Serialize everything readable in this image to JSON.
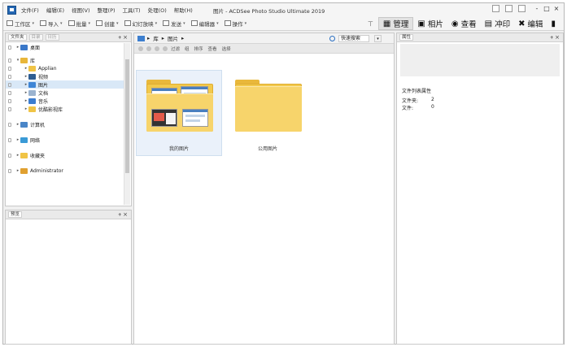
{
  "window": {
    "title": "图片 - ACDSee Photo Studio Ultimate 2019",
    "menu": [
      "文件(F)",
      "编辑(E)",
      "视图(V)",
      "整理(P)",
      "工具(T)",
      "处理(O)",
      "帮助(H)"
    ],
    "controls": {
      "minimize": "-",
      "maximize": "□",
      "close": "×"
    }
  },
  "toolbar": {
    "tools": [
      "工作区",
      "导入",
      "批量",
      "创建",
      "幻灯放映",
      "发送",
      "编辑器",
      "操作"
    ],
    "modes": [
      {
        "label": "管理",
        "icon": "grid-icon",
        "active": true
      },
      {
        "label": "相片",
        "icon": "photo-icon",
        "active": false
      },
      {
        "label": "查看",
        "icon": "eye-icon",
        "active": false
      },
      {
        "label": "冲印",
        "icon": "print-icon",
        "active": false
      },
      {
        "label": "编辑",
        "icon": "tools-icon",
        "active": false
      },
      {
        "label": "",
        "icon": "chart-icon",
        "active": false
      }
    ]
  },
  "left_pane": {
    "tabs": [
      "文件夹",
      "目录",
      "日历"
    ],
    "tree": [
      {
        "label": "桌面",
        "icon": "desktop-icon",
        "color": "#3a78c9",
        "indent": 0,
        "arrow": "▸"
      },
      {
        "label": "库",
        "icon": "library-icon",
        "color": "#e8b63a",
        "indent": 0,
        "arrow": "▾"
      },
      {
        "label": "Applian",
        "icon": "folder-icon",
        "color": "#f0c446",
        "indent": 1,
        "arrow": "▸"
      },
      {
        "label": "视频",
        "icon": "video-icon",
        "color": "#2e5d92",
        "indent": 1,
        "arrow": "▸"
      },
      {
        "label": "图片",
        "icon": "picture-icon",
        "color": "#3f86d6",
        "indent": 1,
        "arrow": "▸",
        "selected": true
      },
      {
        "label": "文档",
        "icon": "document-icon",
        "color": "#9bb3cf",
        "indent": 1,
        "arrow": "▸"
      },
      {
        "label": "音乐",
        "icon": "music-icon",
        "color": "#3b7dd0",
        "indent": 1,
        "arrow": "▸"
      },
      {
        "label": "优酷影视库",
        "icon": "folder-icon",
        "color": "#f0c446",
        "indent": 1,
        "arrow": "▸"
      },
      {
        "label": "计算机",
        "icon": "computer-icon",
        "color": "#4a86c8",
        "indent": 0,
        "arrow": "▸"
      },
      {
        "label": "网络",
        "icon": "network-icon",
        "color": "#3a9ad6",
        "indent": 0,
        "arrow": "▸"
      },
      {
        "label": "收藏夹",
        "icon": "favorites-icon",
        "color": "#f0c446",
        "indent": 0,
        "arrow": "▸"
      },
      {
        "label": "Administrator",
        "icon": "user-icon",
        "color": "#e0a030",
        "indent": 0,
        "arrow": "▸"
      }
    ]
  },
  "preview_pane": {
    "title": "预览"
  },
  "browser": {
    "breadcrumb": [
      "库",
      "图片"
    ],
    "search_label": "快速搜索",
    "filters": [
      "过滤",
      "组",
      "排序",
      "查看",
      "选择"
    ],
    "items": [
      {
        "label": "我的图片",
        "selected": true
      },
      {
        "label": "公用图片",
        "selected": false
      }
    ]
  },
  "properties": {
    "title": "属性",
    "section_title": "文件列表属性",
    "rows": [
      {
        "key": "文件夹:",
        "value": "2"
      },
      {
        "key": "文件:",
        "value": "0"
      }
    ]
  }
}
